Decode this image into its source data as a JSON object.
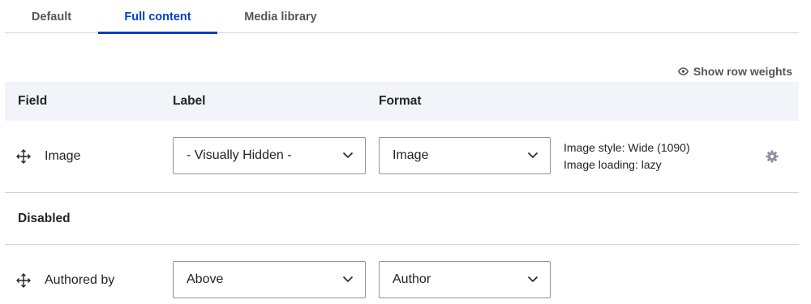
{
  "tabs": [
    {
      "label": "Default",
      "active": false
    },
    {
      "label": "Full content",
      "active": true
    },
    {
      "label": "Media library",
      "active": false
    }
  ],
  "row_weights": {
    "label": "Show row weights",
    "icon": "eye-icon"
  },
  "table": {
    "headers": {
      "field": "Field",
      "label": "Label",
      "format": "Format"
    },
    "rows": [
      {
        "field": "Image",
        "label_select": "- Visually Hidden -",
        "format_select": "Image",
        "summary": [
          "Image style: Wide (1090)",
          "Image loading: lazy"
        ],
        "settings_icon": "gear-icon"
      }
    ],
    "disabled_section": "Disabled",
    "disabled_rows": [
      {
        "field": "Authored by",
        "label_select": "Above",
        "format_select": "Author"
      }
    ]
  },
  "colors": {
    "accent": "#003ecc",
    "header_bg": "#f3f4f9",
    "border": "#d3d4d9",
    "text": "#232429"
  }
}
